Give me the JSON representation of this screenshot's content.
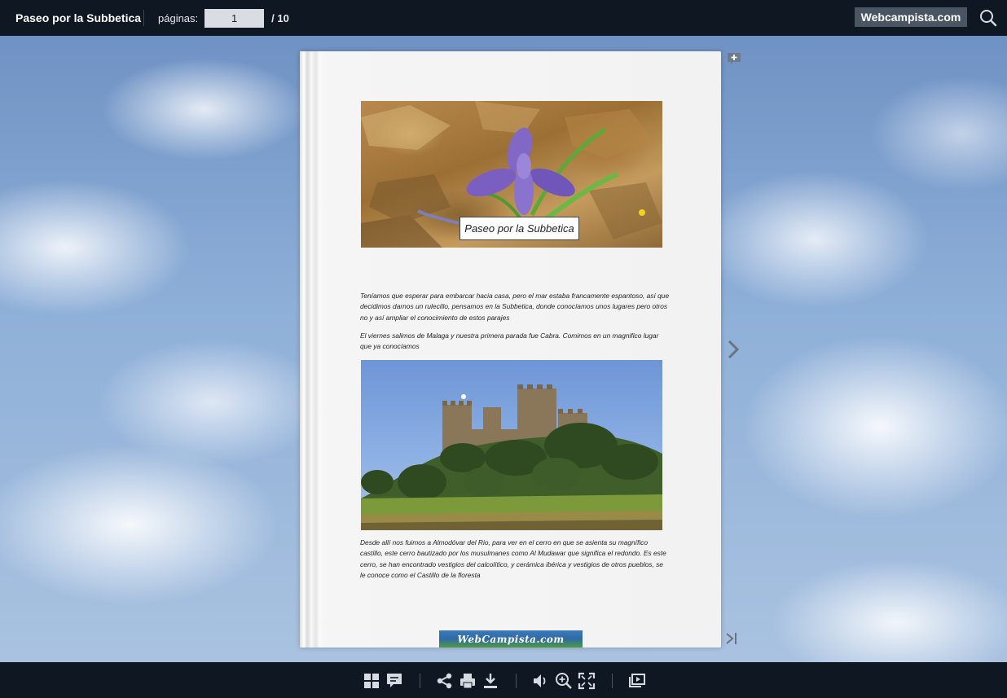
{
  "header": {
    "title": "Paseo por la Subbetica",
    "pages_label": "páginas:",
    "current_page": "1",
    "total_pages": "/  10",
    "brand": "Webcampista.com"
  },
  "book": {
    "hero_caption": "Paseo por la Subbetica",
    "paragraph1": "Teníamos que esperar para embarcar hacia casa, pero el mar estaba francamente espantoso, así que decidimos darnos un rulecillo, pensamos en la Subbetica, donde conocíamos unos lugares pero otros no y así ampliar el conocimiento de estos parajes",
    "paragraph2": "El viernes salimos de Malaga y nuestra primera parada fue Cabra. Comimos en un magnifico lugar que ya conocíamos",
    "paragraph3": "Desde allí nos fuimos a Almodóvar del Rio, para ver en el cerro  en que se asienta su magnífico castillo, este cerro bautizado por los musulmanes  como Al Mudawar que significa el redondo. Es este cerro, se han encontrado vestigios del calcolítico, y cerámica ibérica y vestigios de otros pueblos, se le conoce como el Castillo de la floresta",
    "footer_logo": "WebCampista.com"
  },
  "toolbar": {
    "icons": [
      "thumbnails-icon",
      "notes-icon",
      "share-icon",
      "print-icon",
      "download-icon",
      "sound-icon",
      "zoom-in-icon",
      "fullscreen-icon",
      "slideshow-icon"
    ]
  },
  "colors": {
    "bar_bg": "#0f1722",
    "brand_bg": "#4a5563",
    "icon_color": "#d6dbe2"
  }
}
